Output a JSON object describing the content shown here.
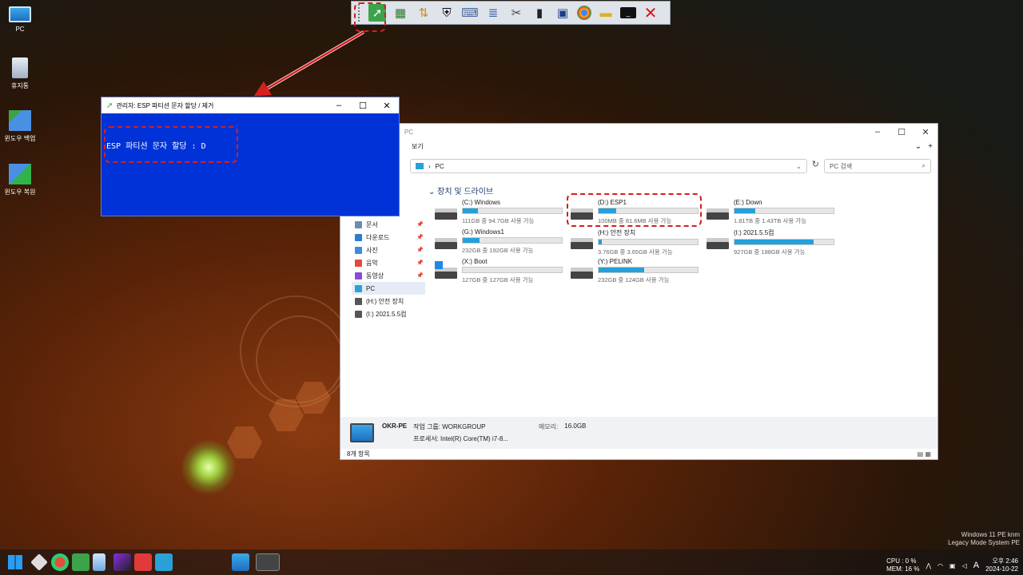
{
  "desktop": {
    "icons": [
      {
        "label": "PC"
      },
      {
        "label": "휴지통"
      },
      {
        "label": "윈도우 백업"
      },
      {
        "label": "윈도우 복원"
      }
    ]
  },
  "toolbar": {
    "icons": [
      "share-icon",
      "gpu-icon",
      "partition-icon",
      "shield-icon",
      "keyboard-icon",
      "ruler-icon",
      "tools-icon",
      "sdcard-icon",
      "monitor-icon",
      "chrome-icon",
      "folder-add-icon",
      "cmd-icon",
      "close-icon"
    ]
  },
  "cmd_window": {
    "title": "관리자: ESP 파티션 문자 할당 / 제거",
    "output": "ESP 파티션 문자 할당 :  D"
  },
  "explorer": {
    "title": "PC",
    "menu_view": "보기",
    "address": "PC",
    "search_placeholder": "PC 검색",
    "section_title": "장치 및 드라이브",
    "nav": [
      {
        "label": "문서",
        "color": "#6b8db5",
        "pinned": true
      },
      {
        "label": "다운로드",
        "color": "#2b7cd3",
        "pinned": true
      },
      {
        "label": "사진",
        "color": "#3a8ee0",
        "pinned": true
      },
      {
        "label": "음악",
        "color": "#e24a3a",
        "pinned": true
      },
      {
        "label": "동영상",
        "color": "#8a4bd4",
        "pinned": true
      },
      {
        "label": "PC",
        "color": "#2aa0d8",
        "pinned": false
      },
      {
        "label": "(H:) 안전 장치",
        "color": "#555555",
        "pinned": false
      },
      {
        "label": "(I:) 2021.5.5컴",
        "color": "#555555",
        "pinned": false
      }
    ],
    "drives": [
      {
        "name": "(C:) Windows",
        "free": "111GB 중 94.7GB 사용 가능",
        "used_fraction": 0.15,
        "windows": false
      },
      {
        "name": "(D:) ESP1",
        "free": "100MB 중 81.6MB 사용 가능",
        "used_fraction": 0.18,
        "windows": false
      },
      {
        "name": "(E:) Down",
        "free": "1.81TB 중 1.43TB 사용 가능",
        "used_fraction": 0.21,
        "windows": false
      },
      {
        "name": "(G:) Windows1",
        "free": "232GB 중 192GB 사용 가능",
        "used_fraction": 0.17,
        "windows": false
      },
      {
        "name": "(H:) 안전 장치",
        "free": "3.76GB 중 3.65GB 사용 가능",
        "used_fraction": 0.03,
        "windows": false
      },
      {
        "name": "(I:) 2021.5.5컴",
        "free": "927GB 중 188GB 사용 가능",
        "used_fraction": 0.8,
        "windows": false
      },
      {
        "name": "(X:) Boot",
        "free": "127GB 중 127GB 사용 가능",
        "used_fraction": 0.0,
        "windows": true
      },
      {
        "name": "(Y:) PELINK",
        "free": "232GB 중 124GB 사용 가능",
        "used_fraction": 0.46,
        "windows": false
      }
    ],
    "details": {
      "computer": "OKR-PE",
      "workgroup_label": "작업 그룹:",
      "workgroup": "WORKGROUP",
      "memory_label": "메모리:",
      "memory": "16.0GB",
      "cpu_label": "프로세서:",
      "cpu": "Intel(R) Core(TM) i7-8..."
    },
    "status": "8개 항목"
  },
  "system": {
    "os_line1": "Windows 11 PE knm",
    "os_line2": "Legacy Mode System PE"
  },
  "tray": {
    "cpu": "CPU :  0 %",
    "mem": "MEM: 16 %",
    "ime": "A",
    "time": "오후 2:46",
    "date": "2024-10-22"
  }
}
